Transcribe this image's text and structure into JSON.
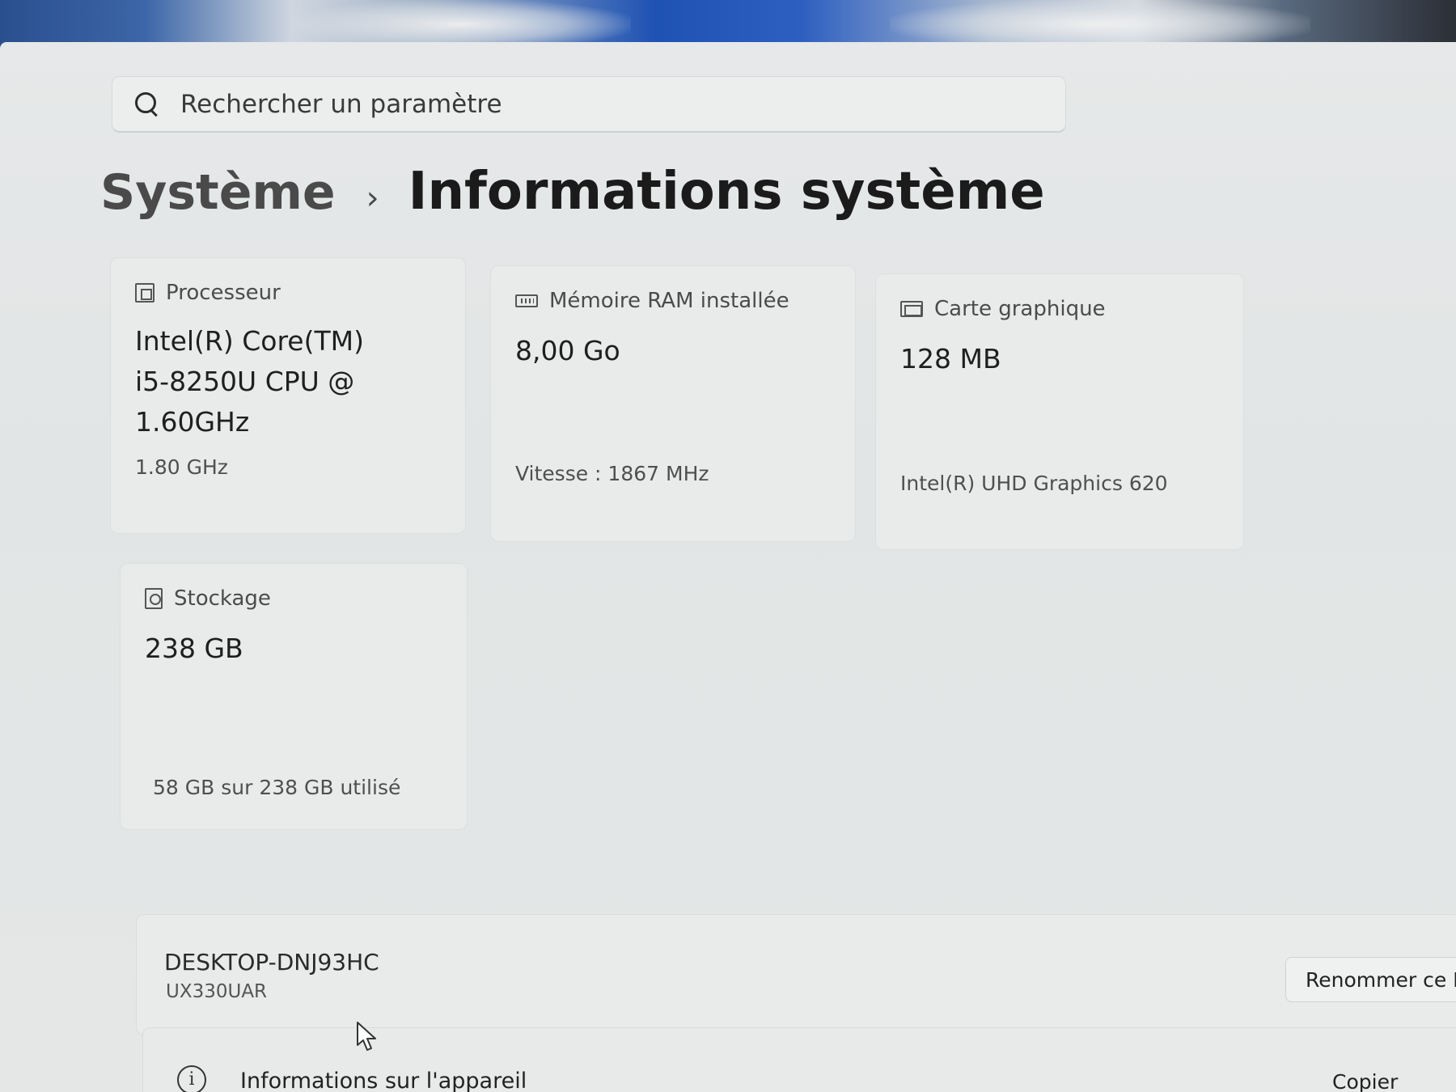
{
  "search": {
    "placeholder": "Rechercher un paramètre"
  },
  "breadcrumb": {
    "parent": "Système",
    "separator": "›",
    "current": "Informations système"
  },
  "cards": {
    "processor": {
      "label": "Processeur",
      "value": "Intel(R) Core(TM) i5-8250U CPU @ 1.60GHz",
      "sub": "1.80 GHz",
      "icon": "processor-icon"
    },
    "ram": {
      "label": "Mémoire RAM installée",
      "value": "8,00 Go",
      "sub": "Vitesse : 1867 MHz",
      "icon": "memory-icon"
    },
    "gpu": {
      "label": "Carte graphique",
      "value": "128 MB",
      "sub": "Intel(R) UHD Graphics 620",
      "icon": "graphics-card-icon"
    },
    "storage": {
      "label": "Stockage",
      "value": "238 GB",
      "sub": "58 GB sur 238 GB utilisé",
      "icon": "storage-icon"
    }
  },
  "device": {
    "name": "DESKTOP-DNJ93HC",
    "model": "UX330UAR",
    "rename_label": "Renommer ce P"
  },
  "device_info": {
    "label": "Informations sur l'appareil",
    "expand_label": "Copier"
  }
}
